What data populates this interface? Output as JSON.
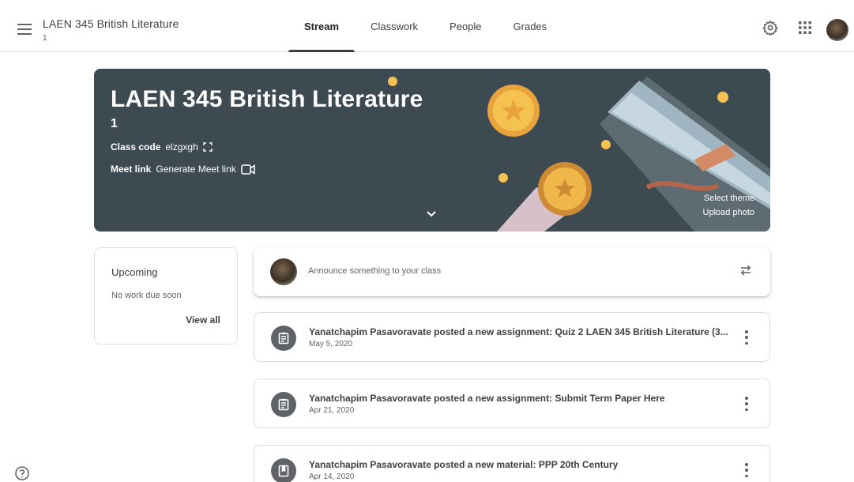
{
  "header": {
    "class_title": "LAEN 345 British Literature",
    "class_section": "1",
    "tabs": [
      {
        "label": "Stream",
        "active": true
      },
      {
        "label": "Classwork",
        "active": false
      },
      {
        "label": "People",
        "active": false
      },
      {
        "label": "Grades",
        "active": false
      }
    ],
    "icons": [
      "menu-icon",
      "settings-icon",
      "apps-grid-icon",
      "account-avatar"
    ]
  },
  "banner": {
    "title": "LAEN 345 British Literature",
    "section": "1",
    "class_code_label": "Class code",
    "class_code_value": "elzgxgh",
    "meet_link_label": "Meet link",
    "meet_link_value": "Generate Meet link",
    "select_theme": "Select theme",
    "upload_photo": "Upload photo",
    "background_color": "#3d4a51"
  },
  "upcoming": {
    "title": "Upcoming",
    "empty_text": "No work due soon",
    "view_all": "View all"
  },
  "announce": {
    "placeholder": "Announce something to your class"
  },
  "posts": [
    {
      "title": "Yanatchapim Pasavoravate posted a new assignment: Quiz 2 LAEN 345 British Literature (3...",
      "date": "May 5, 2020",
      "icon": "assignment-icon"
    },
    {
      "title": "Yanatchapim Pasavoravate posted a new assignment: Submit Term Paper Here",
      "date": "Apr 21, 2020",
      "icon": "assignment-icon"
    },
    {
      "title": "Yanatchapim Pasavoravate posted a new material: PPP 20th Century",
      "date": "Apr 14, 2020",
      "icon": "material-icon"
    }
  ],
  "colors": {
    "accent": "#3c4043",
    "post_icon_bg": "#5f6368"
  }
}
